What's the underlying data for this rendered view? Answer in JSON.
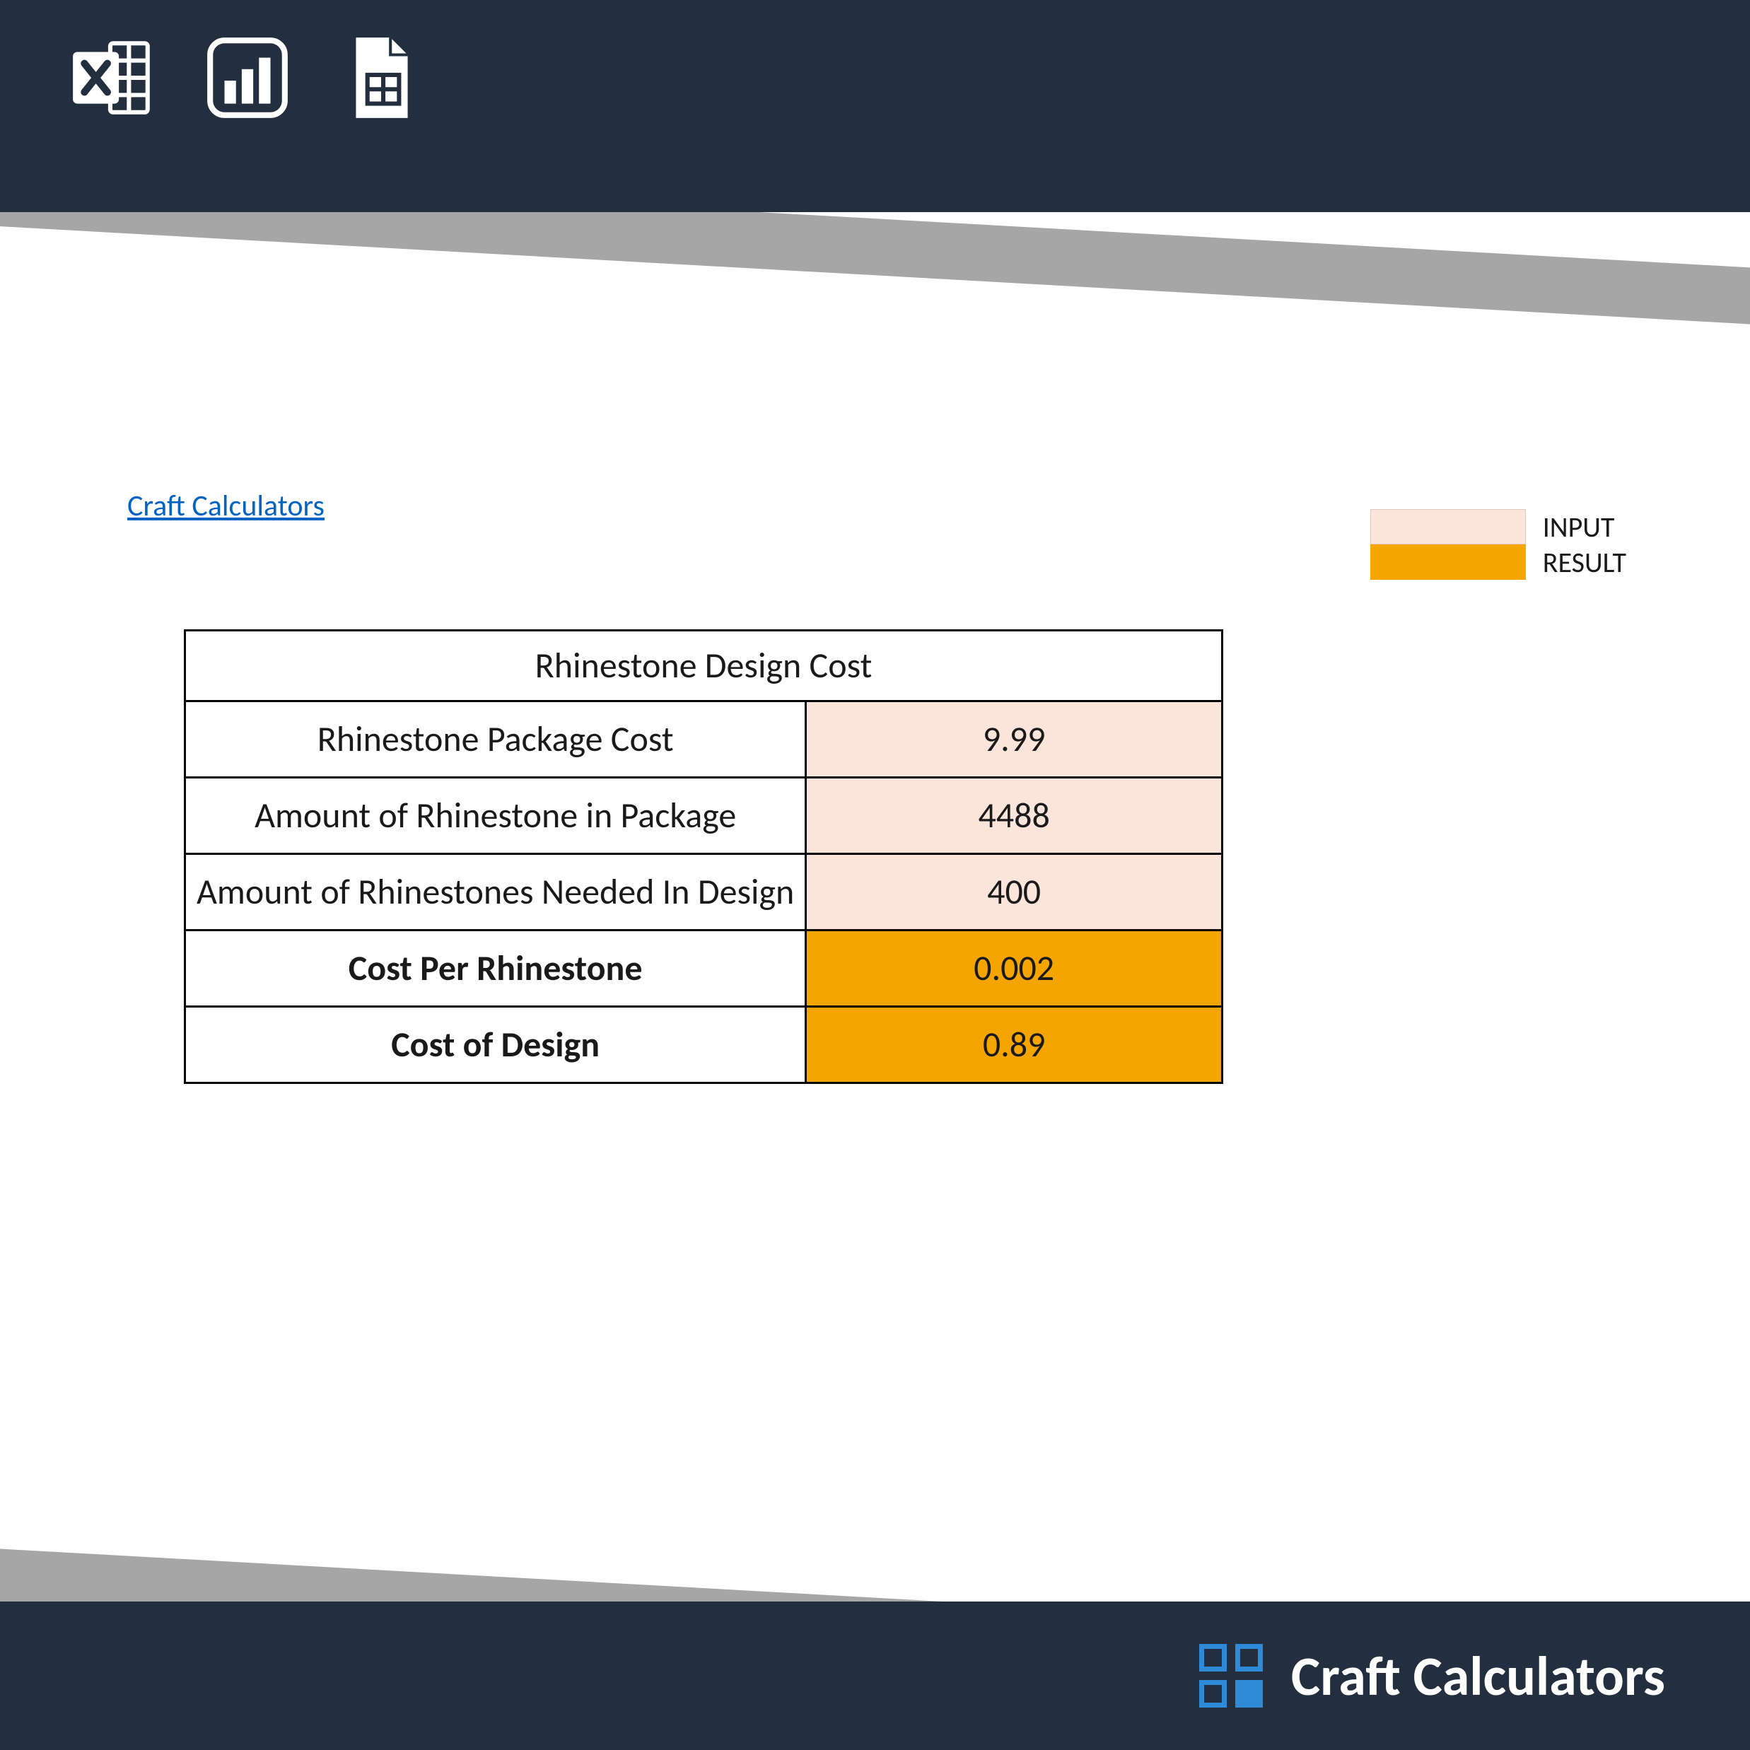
{
  "site_link": "Craft Calculators",
  "legend": {
    "input_label": "INPUT",
    "result_label": "RESULT",
    "colors": {
      "input": "#fbe5da",
      "result": "#f5a500"
    }
  },
  "calculator": {
    "title": "Rhinestone Design Cost",
    "rows": [
      {
        "label": "Rhinestone Package Cost",
        "value": "9.99",
        "type": "input",
        "bold": false
      },
      {
        "label": "Amount of Rhinestone in Package",
        "value": "4488",
        "type": "input",
        "bold": false
      },
      {
        "label": "Amount of Rhinestones Needed In Design",
        "value": "400",
        "type": "input",
        "bold": false
      },
      {
        "label": "Cost Per Rhinestone",
        "value": "0.002",
        "type": "result",
        "bold": true
      },
      {
        "label": "Cost of Design",
        "value": "0.89",
        "type": "result",
        "bold": true
      }
    ]
  },
  "footer": {
    "brand": "Craft Calculators"
  },
  "header_icons": [
    "excel-icon",
    "chart-icon",
    "sheets-icon"
  ]
}
